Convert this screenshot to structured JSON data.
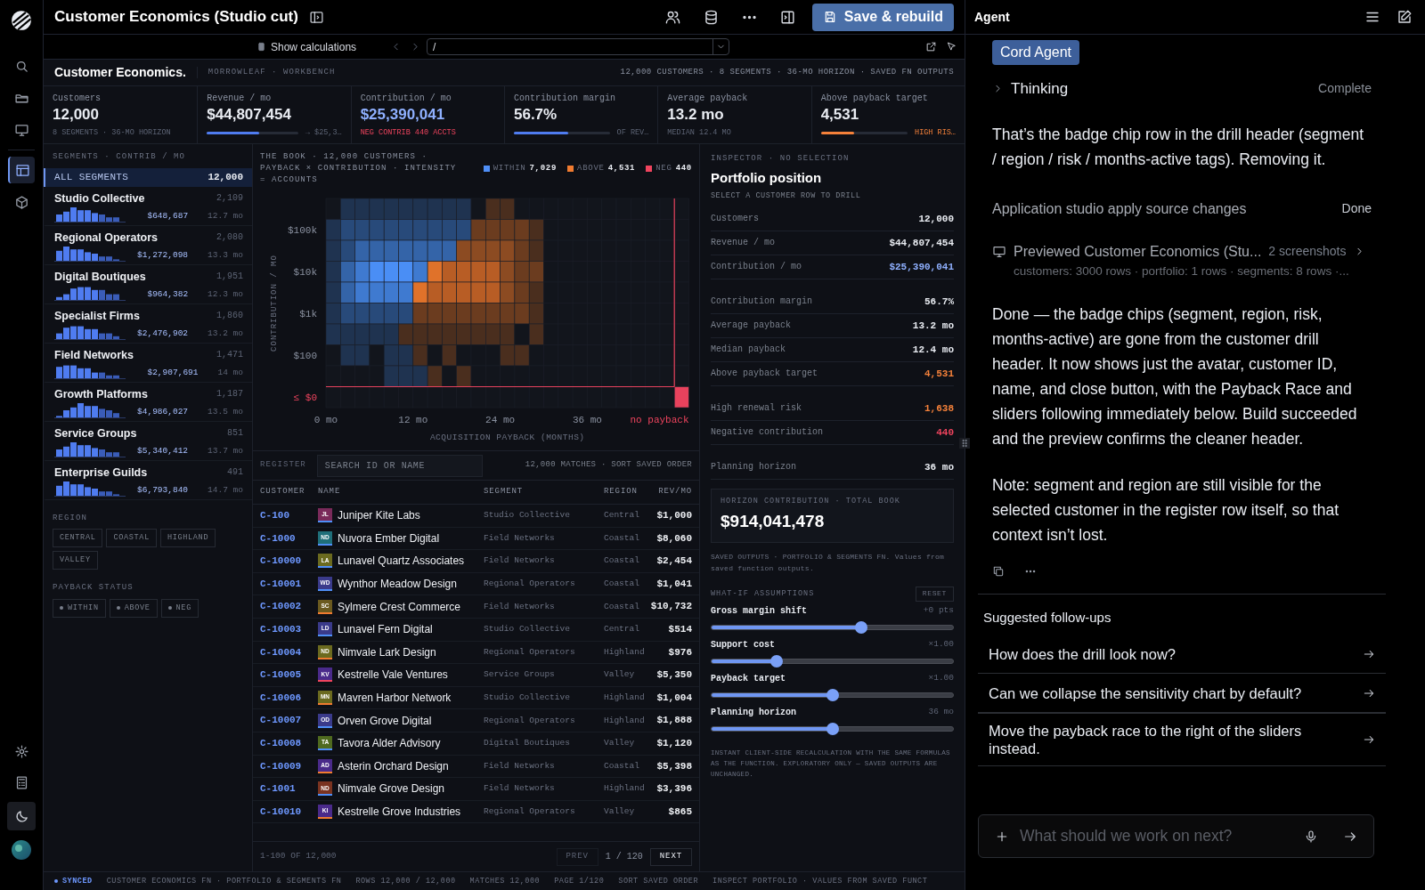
{
  "rail": {
    "items": [
      {
        "selected": false
      },
      {
        "selected": false
      },
      {
        "selected": false
      },
      {
        "selected": true
      },
      {
        "selected": false
      }
    ]
  },
  "app_bar": {
    "title": "Customer Economics (Studio cut)",
    "save_button": "Save & rebuild"
  },
  "preview_bar": {
    "toggle_label": "Show calculations",
    "path": "/"
  },
  "workbench": {
    "brand": "Customer Economics.",
    "subtitle": "MORROWLEAF · WORKBENCH",
    "summary": "12,000 CUSTOMERS · 8 SEGMENTS · 36-MO HORIZON · SAVED FN OUTPUTS"
  },
  "kpis": [
    {
      "label": "Customers",
      "value": "12,000",
      "accent": false,
      "note": {
        "text": "8 SEGMENTS · 36-MO HORIZON",
        "kind": "muted"
      }
    },
    {
      "label": "Revenue / mo",
      "value": "$44,807,454",
      "accent": false,
      "bar": {
        "level": 0.57,
        "kind": "accent"
      },
      "note": {
        "text": "→ $25,3…",
        "kind": "muted"
      }
    },
    {
      "label": "Contribution / mo",
      "value": "$25,390,041",
      "accent": true,
      "note": {
        "text": "NEG CONTRIB 440 ACCTS",
        "kind": "negative"
      }
    },
    {
      "label": "Contribution margin",
      "value": "56.7%",
      "accent": false,
      "bar": {
        "level": 0.57,
        "kind": "accent"
      },
      "note": {
        "text": "OF REV…",
        "kind": "muted"
      }
    },
    {
      "label": "Average payback",
      "value": "13.2 mo",
      "accent": false,
      "note": {
        "text": "MEDIAN 12.4 MO",
        "kind": "muted"
      }
    },
    {
      "label": "Above payback target",
      "value": "4,531",
      "accent": false,
      "bar": {
        "level": 0.38,
        "kind": "warning"
      },
      "note": {
        "text": "HIGH RIS…",
        "kind": "warning"
      }
    }
  ],
  "segments": {
    "title": "SEGMENTS · CONTRIB / MO",
    "items": [
      {
        "kind": "all",
        "name": "ALL SEGMENTS",
        "count": "12,000",
        "selected": true
      },
      {
        "kind": "segment",
        "name": "Studio Collective",
        "count": "2,109",
        "contribution": "$648,687",
        "payback": "12.7 mo",
        "selected": false
      },
      {
        "kind": "segment",
        "name": "Regional Operators",
        "count": "2,080",
        "contribution": "$1,272,098",
        "payback": "13.3 mo",
        "selected": false
      },
      {
        "kind": "segment",
        "name": "Digital Boutiques",
        "count": "1,951",
        "contribution": "$964,382",
        "payback": "12.3 mo",
        "selected": false
      },
      {
        "kind": "segment",
        "name": "Specialist Firms",
        "count": "1,860",
        "contribution": "$2,476,902",
        "payback": "13.2 mo",
        "selected": false
      },
      {
        "kind": "segment",
        "name": "Field Networks",
        "count": "1,471",
        "contribution": "$2,907,691",
        "payback": "14 mo",
        "selected": false
      },
      {
        "kind": "segment",
        "name": "Growth Platforms",
        "count": "1,187",
        "contribution": "$4,986,027",
        "payback": "13.5 mo",
        "selected": false
      },
      {
        "kind": "segment",
        "name": "Service Groups",
        "count": "851",
        "contribution": "$5,340,412",
        "payback": "13.7 mo",
        "selected": false
      },
      {
        "kind": "segment",
        "name": "Enterprise Guilds",
        "count": "491",
        "contribution": "$6,793,840",
        "payback": "14.7 mo",
        "selected": false
      }
    ]
  },
  "filters": [
    {
      "title": "REGION",
      "kind": "plain",
      "chips": [
        {
          "label": "CENTRAL",
          "selected": false
        },
        {
          "label": "COASTAL",
          "selected": false
        },
        {
          "label": "HIGHLAND",
          "selected": false
        },
        {
          "label": "VALLEY",
          "selected": false
        }
      ]
    },
    {
      "title": "PAYBACK STATUS",
      "kind": "dot",
      "chips": [
        {
          "label": "WITHIN",
          "selected": false
        },
        {
          "label": "ABOVE",
          "selected": false
        },
        {
          "label": "NEG",
          "selected": false
        }
      ]
    }
  ],
  "heatmap": {
    "caption": "THE BOOK · 12,000 CUSTOMERS · PAYBACK × CONTRIBUTION · INTENSITY = ACCOUNTS",
    "legend": [
      {
        "label": "WITHIN",
        "count": "7,029",
        "color": "#4f8ff7"
      },
      {
        "label": "ABOVE",
        "count": "4,531",
        "color": "#f07b30"
      },
      {
        "label": "NEG",
        "count": "440",
        "color": "#f0445e"
      }
    ],
    "y_label": "CONTRIBUTION / MO",
    "y_ticks": [
      {
        "label": "$100k",
        "negative": false
      },
      {
        "label": "$10k",
        "negative": false
      },
      {
        "label": "$1k",
        "negative": false
      },
      {
        "label": "$100",
        "negative": false
      },
      {
        "label": "≤ $0",
        "negative": true
      }
    ],
    "x_ticks": [
      {
        "label": "0 mo",
        "negative": false
      },
      {
        "label": "12 mo",
        "negative": false
      },
      {
        "label": "24 mo",
        "negative": false
      },
      {
        "label": "36 mo",
        "negative": false
      },
      {
        "label": "no payback",
        "negative": true
      }
    ],
    "x_label": "ACQUISITION PAYBACK (MONTHS)"
  },
  "register": {
    "title": "REGISTER",
    "search_placeholder": "SEARCH ID OR NAME",
    "summary": "12,000 MATCHES · SORT SAVED ORDER",
    "columns": [
      "CUSTOMER",
      "NAME",
      "SEGMENT",
      "REGION",
      "REV/MO"
    ],
    "rows": [
      {
        "id": "C-100",
        "initials": "JL",
        "color": "#7a2a5a",
        "kind": "within",
        "name": "Juniper Kite Labs",
        "segment": "Studio Collective",
        "region": "Central",
        "revenue": "$1,000"
      },
      {
        "id": "C-1000",
        "initials": "ND",
        "color": "#1f6f7a",
        "kind": "within",
        "name": "Nuvora Ember Digital",
        "segment": "Field Networks",
        "region": "Coastal",
        "revenue": "$8,060"
      },
      {
        "id": "C-10000",
        "initials": "LA",
        "color": "#6b6a1f",
        "kind": "within",
        "name": "Lunavel Quartz Associates",
        "segment": "Field Networks",
        "region": "Coastal",
        "revenue": "$2,454"
      },
      {
        "id": "C-10001",
        "initials": "WD",
        "color": "#3a3a8a",
        "kind": "within",
        "name": "Wynthor Meadow Design",
        "segment": "Regional Operators",
        "region": "Coastal",
        "revenue": "$1,041"
      },
      {
        "id": "C-10002",
        "initials": "SC",
        "color": "#6b5a1f",
        "kind": "above",
        "name": "Sylmere Crest Commerce",
        "segment": "Field Networks",
        "region": "Coastal",
        "revenue": "$10,732"
      },
      {
        "id": "C-10003",
        "initials": "LD",
        "color": "#3a3a8a",
        "kind": "within",
        "name": "Lunavel Fern Digital",
        "segment": "Studio Collective",
        "region": "Central",
        "revenue": "$514"
      },
      {
        "id": "C-10004",
        "initials": "ND",
        "color": "#6b6a1f",
        "kind": "above",
        "name": "Nimvale Lark Design",
        "segment": "Regional Operators",
        "region": "Highland",
        "revenue": "$976"
      },
      {
        "id": "C-10005",
        "initials": "KV",
        "color": "#4a2a8a",
        "kind": "neg",
        "name": "Kestrelle Vale Ventures",
        "segment": "Service Groups",
        "region": "Valley",
        "revenue": "$5,350"
      },
      {
        "id": "C-10006",
        "initials": "MN",
        "color": "#6b6a1f",
        "kind": "above",
        "name": "Mavren Harbor Network",
        "segment": "Studio Collective",
        "region": "Highland",
        "revenue": "$1,004"
      },
      {
        "id": "C-10007",
        "initials": "OD",
        "color": "#3a3a8a",
        "kind": "within",
        "name": "Orven Grove Digital",
        "segment": "Regional Operators",
        "region": "Highland",
        "revenue": "$1,888"
      },
      {
        "id": "C-10008",
        "initials": "TA",
        "color": "#4f6a1f",
        "kind": "within",
        "name": "Tavora Alder Advisory",
        "segment": "Digital Boutiques",
        "region": "Valley",
        "revenue": "$1,120"
      },
      {
        "id": "C-10009",
        "initials": "AD",
        "color": "#4a2a8a",
        "kind": "above",
        "name": "Asterin Orchard Design",
        "segment": "Field Networks",
        "region": "Coastal",
        "revenue": "$5,398"
      },
      {
        "id": "C-1001",
        "initials": "ND",
        "color": "#7a3320",
        "kind": "within",
        "name": "Nimvale Grove Design",
        "segment": "Field Networks",
        "region": "Highland",
        "revenue": "$3,396"
      },
      {
        "id": "C-10010",
        "initials": "KI",
        "color": "#4a2a8a",
        "kind": "above",
        "name": "Kestrelle Grove Industries",
        "segment": "Regional Operators",
        "region": "Valley",
        "revenue": "$865"
      }
    ],
    "range": "1-100 OF 12,000",
    "prev": {
      "label": "PREV",
      "disabled": true
    },
    "page": "1 / 120",
    "next": {
      "label": "NEXT",
      "disabled": false
    }
  },
  "inspector": {
    "eyebrow": "INSPECTOR · NO SELECTION",
    "title": "Portfolio position",
    "hint": "SELECT A CUSTOMER ROW TO DRILL",
    "groups": [
      [
        {
          "label": "Customers",
          "value": "12,000",
          "kind": "plain"
        },
        {
          "label": "Revenue / mo",
          "value": "$44,807,454",
          "kind": "plain"
        },
        {
          "label": "Contribution / mo",
          "value": "$25,390,041",
          "kind": "accent"
        }
      ],
      [
        {
          "label": "Contribution margin",
          "value": "56.7%",
          "kind": "plain"
        },
        {
          "label": "Average payback",
          "value": "13.2 mo",
          "kind": "plain"
        },
        {
          "label": "Median payback",
          "value": "12.4 mo",
          "kind": "plain"
        },
        {
          "label": "Above payback target",
          "value": "4,531",
          "kind": "warning"
        }
      ],
      [
        {
          "label": "High renewal risk",
          "value": "1,638",
          "kind": "warning"
        },
        {
          "label": "Negative contribution",
          "value": "440",
          "kind": "negative"
        }
      ],
      [
        {
          "label": "Planning horizon",
          "value": "36 mo",
          "kind": "plain"
        }
      ]
    ],
    "total": {
      "label": "HORIZON CONTRIBUTION · TOTAL BOOK",
      "value": "$914,041,478"
    },
    "source_note": "SAVED OUTPUTS · PORTFOLIO & SEGMENTS FN. Values from saved function outputs.",
    "whatif": {
      "title": "WHAT-IF ASSUMPTIONS",
      "reset": "RESET",
      "sliders": [
        {
          "label": "Gross margin shift",
          "reading": "+0 pts",
          "level": 0.62
        },
        {
          "label": "Support cost",
          "reading": "×1.00",
          "level": 0.27
        },
        {
          "label": "Payback target",
          "reading": "×1.00",
          "level": 0.5
        },
        {
          "label": "Planning horizon",
          "reading": "36 mo",
          "level": 0.5
        }
      ],
      "footnote": "INSTANT CLIENT-SIDE RECALCULATION WITH THE SAME FORMULAS AS THE FUNCTION. EXPLORATORY ONLY — SAVED OUTPUTS ARE UNCHANGED."
    }
  },
  "status_bar": {
    "sync": "SYNCED",
    "items": [
      "CUSTOMER ECONOMICS FN · PORTFOLIO & SEGMENTS FN",
      "ROWS 12,000 / 12,000",
      "MATCHES 12,000",
      "PAGE 1/120",
      "SORT SAVED ORDER",
      "INSPECT PORTFOLIO · VALUES FROM SAVED FUNCT"
    ]
  },
  "agent": {
    "title": "Agent",
    "badge": "Cord Agent",
    "thinking": {
      "label": "Thinking",
      "status": "Complete",
      "expanded": false
    },
    "blocks": [
      {
        "kind": "text",
        "text": "That’s the badge chip row in the drill header (segment / region / risk / months-active tags). Removing it."
      },
      {
        "kind": "tool",
        "label": "Application studio apply source changes",
        "status": "Done"
      },
      {
        "kind": "preview",
        "label": "Previewed Customer Economics (Stu...",
        "meta": "2 screenshots",
        "detail": "customers: 3000 rows · portfolio: 1 rows · segments: 8 rows ·..."
      },
      {
        "kind": "text",
        "text": "Done — the badge chips (segment, region, risk, months-active) are gone from the customer drill header. It now shows just the avatar, customer ID, name, and close button, with the Payback Race and sliders following immediately below. Build succeeded and the preview confirms the cleaner header."
      },
      {
        "kind": "text",
        "text": "Note: segment and region are still visible for the selected customer in the register row itself, so that context isn’t lost."
      }
    ],
    "followups_title": "Suggested follow-ups",
    "followups": [
      "How does the drill look now?",
      "Can we collapse the sensitivity chart by default?",
      "Move the payback race to the right of the sliders instead."
    ],
    "composer_placeholder": "What should we work on next?"
  }
}
